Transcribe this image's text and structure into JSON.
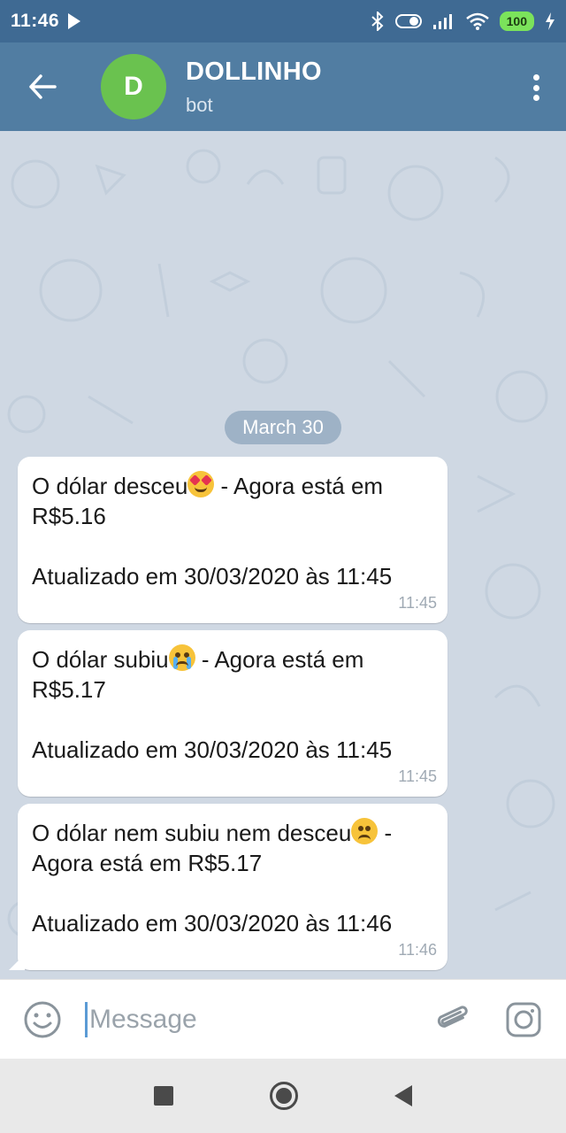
{
  "status_bar": {
    "time": "11:46",
    "battery": "100"
  },
  "header": {
    "avatar_letter": "D",
    "title": "DOLLINHO",
    "subtitle": "bot"
  },
  "chat": {
    "date_chip": "March 30",
    "messages": [
      {
        "text_a": "O dólar desceu",
        "emoji": "heart-eyes-emoji",
        "text_b": " - Agora está em",
        "text_c": "R$5.16",
        "updated": "Atualizado em 30/03/2020 às 11:45",
        "time": "11:45"
      },
      {
        "text_a": "O dólar subiu",
        "emoji": "crying-emoji",
        "text_b": " - Agora está em",
        "text_c": "R$5.17",
        "updated": "Atualizado em 30/03/2020 às 11:45",
        "time": "11:45"
      },
      {
        "text_a": "O dólar nem subiu nem desceu",
        "emoji": "confused-emoji",
        "text_b": " -",
        "text_c": "Agora está em R$5.17",
        "updated": "Atualizado em 30/03/2020 às 11:46",
        "time": "11:46"
      }
    ]
  },
  "input": {
    "placeholder": "Message"
  },
  "colors": {
    "header": "#517da2",
    "status": "#3f6a93",
    "chat_bg": "#cfd8e3",
    "avatar": "#6ac24f",
    "date_chip": "#9eb2c6"
  }
}
